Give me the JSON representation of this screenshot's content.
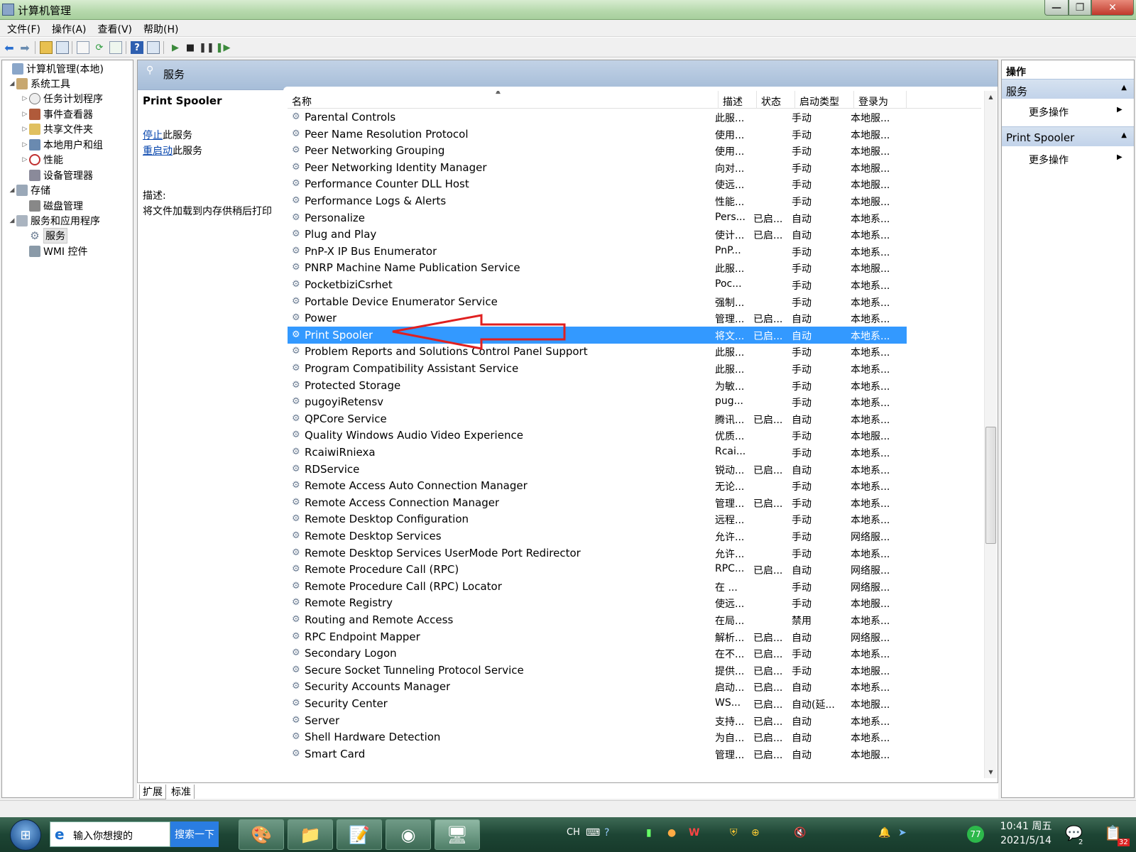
{
  "window": {
    "title": "计算机管理"
  },
  "menu": [
    "文件(F)",
    "操作(A)",
    "查看(V)",
    "帮助(H)"
  ],
  "tree": {
    "items": [
      {
        "label": "计算机管理(本地)",
        "icon": "computer-mgmt-icon"
      },
      {
        "label": "系统工具",
        "icon": "tools-icon"
      },
      {
        "label": "任务计划程序",
        "icon": "clock-icon"
      },
      {
        "label": "事件查看器",
        "icon": "event-viewer-icon"
      },
      {
        "label": "共享文件夹",
        "icon": "shared-folder-icon"
      },
      {
        "label": "本地用户和组",
        "icon": "users-icon"
      },
      {
        "label": "性能",
        "icon": "performance-icon"
      },
      {
        "label": "设备管理器",
        "icon": "device-manager-icon"
      },
      {
        "label": "存储",
        "icon": "storage-icon"
      },
      {
        "label": "磁盘管理",
        "icon": "disk-icon"
      },
      {
        "label": "服务和应用程序",
        "icon": "services-apps-icon"
      },
      {
        "label": "服务",
        "icon": "gear-icon"
      },
      {
        "label": "WMI 控件",
        "icon": "wmi-icon"
      }
    ]
  },
  "center": {
    "header": "服务",
    "selected_name": "Print Spooler",
    "stop_link": "停止",
    "stop_suffix": "此服务",
    "restart_link": "重启动",
    "restart_suffix": "此服务",
    "desc_label": "描述:",
    "desc_text": "将文件加载到内存供稍后打印"
  },
  "columns": [
    "名称",
    "描述",
    "状态",
    "启动类型",
    "登录为"
  ],
  "rows": [
    {
      "name": "Parental Controls",
      "desc": "此服...",
      "status": "",
      "startup": "手动",
      "logon": "本地服..."
    },
    {
      "name": "Peer Name Resolution Protocol",
      "desc": "使用...",
      "status": "",
      "startup": "手动",
      "logon": "本地服..."
    },
    {
      "name": "Peer Networking Grouping",
      "desc": "使用...",
      "status": "",
      "startup": "手动",
      "logon": "本地服..."
    },
    {
      "name": "Peer Networking Identity Manager",
      "desc": "向对...",
      "status": "",
      "startup": "手动",
      "logon": "本地服..."
    },
    {
      "name": "Performance Counter DLL Host",
      "desc": "使远...",
      "status": "",
      "startup": "手动",
      "logon": "本地服..."
    },
    {
      "name": "Performance Logs & Alerts",
      "desc": "性能...",
      "status": "",
      "startup": "手动",
      "logon": "本地服..."
    },
    {
      "name": "Personalize",
      "desc": "Pers...",
      "status": "已启...",
      "startup": "自动",
      "logon": "本地系..."
    },
    {
      "name": "Plug and Play",
      "desc": "使计...",
      "status": "已启...",
      "startup": "自动",
      "logon": "本地系..."
    },
    {
      "name": "PnP-X IP Bus Enumerator",
      "desc": "PnP...",
      "status": "",
      "startup": "手动",
      "logon": "本地系..."
    },
    {
      "name": "PNRP Machine Name Publication Service",
      "desc": "此服...",
      "status": "",
      "startup": "手动",
      "logon": "本地服..."
    },
    {
      "name": "PocketbiziCsrhet",
      "desc": "Poc...",
      "status": "",
      "startup": "手动",
      "logon": "本地系..."
    },
    {
      "name": "Portable Device Enumerator Service",
      "desc": "强制...",
      "status": "",
      "startup": "手动",
      "logon": "本地系..."
    },
    {
      "name": "Power",
      "desc": "管理...",
      "status": "已启...",
      "startup": "自动",
      "logon": "本地系..."
    },
    {
      "name": "Print Spooler",
      "desc": "将文...",
      "status": "已启...",
      "startup": "自动",
      "logon": "本地系..."
    },
    {
      "name": "Problem Reports and Solutions Control Panel Support",
      "desc": "此服...",
      "status": "",
      "startup": "手动",
      "logon": "本地系..."
    },
    {
      "name": "Program Compatibility Assistant Service",
      "desc": "此服...",
      "status": "",
      "startup": "手动",
      "logon": "本地系..."
    },
    {
      "name": "Protected Storage",
      "desc": "为敏...",
      "status": "",
      "startup": "手动",
      "logon": "本地系..."
    },
    {
      "name": "pugoyiRetensv",
      "desc": "pug...",
      "status": "",
      "startup": "手动",
      "logon": "本地系..."
    },
    {
      "name": "QPCore Service",
      "desc": "腾讯...",
      "status": "已启...",
      "startup": "自动",
      "logon": "本地系..."
    },
    {
      "name": "Quality Windows Audio Video Experience",
      "desc": "优质...",
      "status": "",
      "startup": "手动",
      "logon": "本地服..."
    },
    {
      "name": "RcaiwiRniexa",
      "desc": "Rcai...",
      "status": "",
      "startup": "手动",
      "logon": "本地系..."
    },
    {
      "name": "RDService",
      "desc": "锐动...",
      "status": "已启...",
      "startup": "自动",
      "logon": "本地系..."
    },
    {
      "name": "Remote Access Auto Connection Manager",
      "desc": "无论...",
      "status": "",
      "startup": "手动",
      "logon": "本地系..."
    },
    {
      "name": "Remote Access Connection Manager",
      "desc": "管理...",
      "status": "已启...",
      "startup": "手动",
      "logon": "本地系..."
    },
    {
      "name": "Remote Desktop Configuration",
      "desc": "远程...",
      "status": "",
      "startup": "手动",
      "logon": "本地系..."
    },
    {
      "name": "Remote Desktop Services",
      "desc": "允许...",
      "status": "",
      "startup": "手动",
      "logon": "网络服..."
    },
    {
      "name": "Remote Desktop Services UserMode Port Redirector",
      "desc": "允许...",
      "status": "",
      "startup": "手动",
      "logon": "本地系..."
    },
    {
      "name": "Remote Procedure Call (RPC)",
      "desc": "RPC...",
      "status": "已启...",
      "startup": "自动",
      "logon": "网络服..."
    },
    {
      "name": "Remote Procedure Call (RPC) Locator",
      "desc": "在 ...",
      "status": "",
      "startup": "手动",
      "logon": "网络服..."
    },
    {
      "name": "Remote Registry",
      "desc": "使远...",
      "status": "",
      "startup": "手动",
      "logon": "本地服..."
    },
    {
      "name": "Routing and Remote Access",
      "desc": "在局...",
      "status": "",
      "startup": "禁用",
      "logon": "本地系..."
    },
    {
      "name": "RPC Endpoint Mapper",
      "desc": "解析...",
      "status": "已启...",
      "startup": "自动",
      "logon": "网络服..."
    },
    {
      "name": "Secondary Logon",
      "desc": "在不...",
      "status": "已启...",
      "startup": "手动",
      "logon": "本地系..."
    },
    {
      "name": "Secure Socket Tunneling Protocol Service",
      "desc": "提供...",
      "status": "已启...",
      "startup": "手动",
      "logon": "本地服..."
    },
    {
      "name": "Security Accounts Manager",
      "desc": "启动...",
      "status": "已启...",
      "startup": "自动",
      "logon": "本地系..."
    },
    {
      "name": "Security Center",
      "desc": "WS...",
      "status": "已启...",
      "startup": "自动(延...",
      "logon": "本地服..."
    },
    {
      "name": "Server",
      "desc": "支持...",
      "status": "已启...",
      "startup": "自动",
      "logon": "本地系..."
    },
    {
      "name": "Shell Hardware Detection",
      "desc": "为自...",
      "status": "已启...",
      "startup": "自动",
      "logon": "本地系..."
    },
    {
      "name": "Smart Card",
      "desc": "管理...",
      "status": "已启...",
      "startup": "自动",
      "logon": "本地服..."
    }
  ],
  "selected_row_index": 13,
  "bottom_tabs": [
    "扩展",
    "标准"
  ],
  "actions": {
    "title": "操作",
    "sections": [
      {
        "title": "服务",
        "item": "更多操作"
      },
      {
        "title": "Print Spooler",
        "item": "更多操作"
      }
    ]
  },
  "taskbar": {
    "search_placeholder": "输入你想搜的",
    "search_button": "搜索一下",
    "lang": "CH",
    "clock_time": "10:41 周五",
    "clock_date": "2021/5/14",
    "badge_a": "77",
    "badge_b": "2",
    "badge_c": "32"
  },
  "colors": {
    "selection": "#3399ff",
    "arrow": "#e02020",
    "header_blue": "#a6bdd8"
  }
}
